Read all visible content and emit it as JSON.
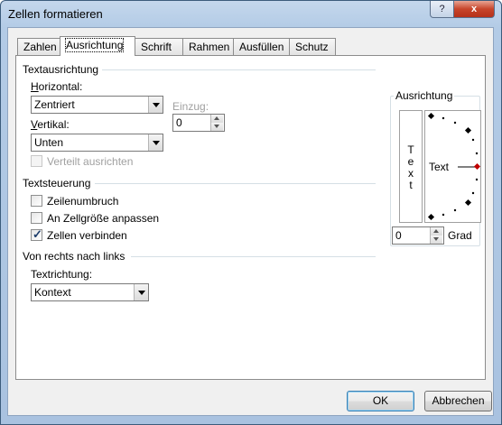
{
  "window": {
    "title": "Zellen formatieren",
    "help_glyph": "?",
    "close_glyph": "x"
  },
  "tabs": [
    {
      "label": "Zahlen",
      "active": false
    },
    {
      "label": "Ausrichtung",
      "active": true
    },
    {
      "label": "Schrift",
      "active": false
    },
    {
      "label": "Rahmen",
      "active": false
    },
    {
      "label": "Ausfüllen",
      "active": false
    },
    {
      "label": "Schutz",
      "active": false
    }
  ],
  "text_alignment": {
    "group": "Textausrichtung",
    "horizontal_label": "Horizontal:",
    "horizontal_value": "Zentriert",
    "indent_label": "Einzug:",
    "indent_value": "0",
    "vertical_label": "Vertikal:",
    "vertical_value": "Unten",
    "distributed_label": "Verteilt ausrichten",
    "distributed_checked": false
  },
  "text_control": {
    "group": "Textsteuerung",
    "wrap_label": "Zeilenumbruch",
    "wrap_checked": false,
    "shrink_label": "An Zellgröße anpassen",
    "shrink_checked": false,
    "merge_label": "Zellen verbinden",
    "merge_checked": true
  },
  "rtl": {
    "group": "Von rechts nach links",
    "direction_label": "Textrichtung:",
    "direction_value": "Kontext"
  },
  "orientation": {
    "group": "Ausrichtung",
    "vertical_text": [
      "T",
      "e",
      "x",
      "t"
    ],
    "dial_text": "Text",
    "degrees_value": "0",
    "degrees_label": "Grad"
  },
  "buttons": {
    "ok": "OK",
    "cancel": "Abbrechen"
  },
  "colors": {
    "accent_marker": "#c00000",
    "default_button_border": "#3c7fb1"
  }
}
